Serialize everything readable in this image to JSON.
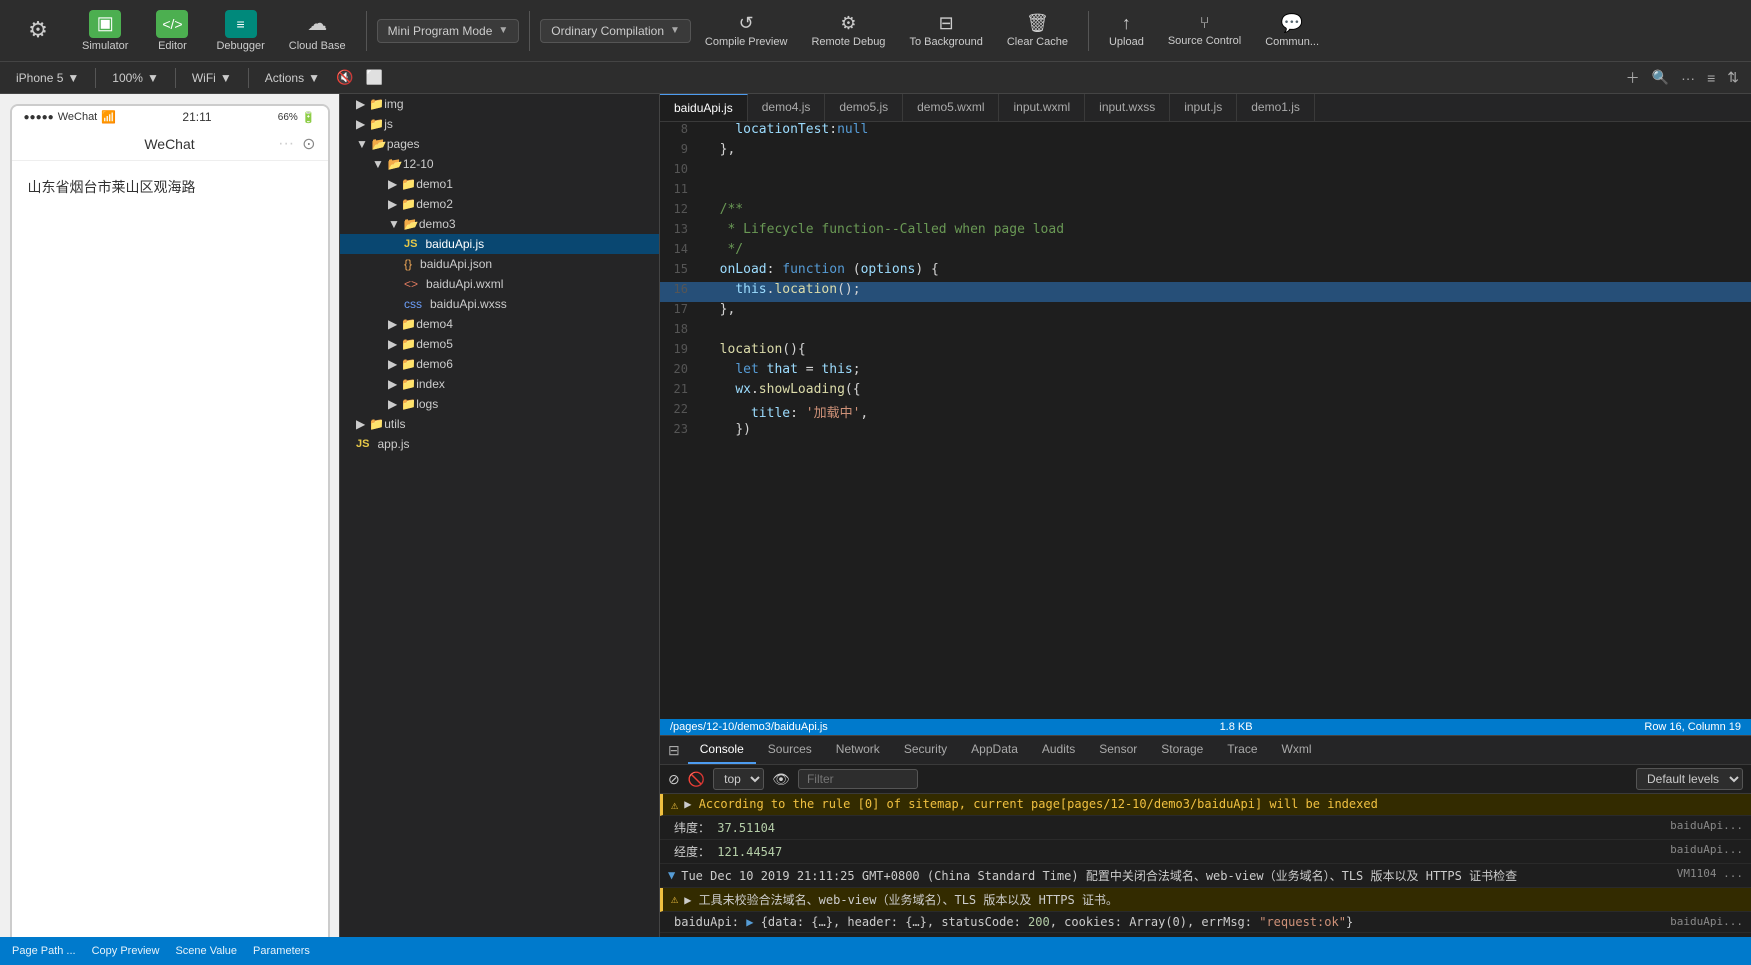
{
  "toolbar": {
    "items": [
      {
        "id": "simulator",
        "label": "Simulator",
        "icon": "▣",
        "style": "green"
      },
      {
        "id": "editor",
        "label": "Editor",
        "icon": "</>",
        "style": "green2"
      },
      {
        "id": "debugger",
        "label": "Debugger",
        "icon": "≡",
        "style": "teal"
      },
      {
        "id": "cloudbase",
        "label": "Cloud Base",
        "icon": "☁",
        "style": "plain"
      }
    ],
    "mode_label": "Mini Program Mode",
    "compile_label": "Ordinary Compilation",
    "compile_preview": "Compile Preview",
    "remote_debug": "Remote Debug",
    "to_background": "To Background",
    "clear_cache": "Clear Cache",
    "upload": "Upload",
    "source_control": "Source Control",
    "commun": "Commun..."
  },
  "subtoolbar": {
    "device": "iPhone 5",
    "zoom": "100%",
    "network": "WiFi",
    "actions": "Actions"
  },
  "phone": {
    "time": "21:11",
    "battery": "66%",
    "signal": "●●●●●",
    "wechat": "WeChat",
    "nav_title": "WeChat",
    "location": "山东省烟台市莱山区观海路"
  },
  "file_tree": {
    "items": [
      {
        "id": "img",
        "label": "img",
        "type": "folder",
        "level": 0,
        "expanded": false
      },
      {
        "id": "js",
        "label": "js",
        "type": "folder",
        "level": 0,
        "expanded": false
      },
      {
        "id": "pages",
        "label": "pages",
        "type": "folder",
        "level": 0,
        "expanded": true
      },
      {
        "id": "12-10",
        "label": "12-10",
        "type": "folder",
        "level": 1,
        "expanded": true
      },
      {
        "id": "demo1",
        "label": "demo1",
        "type": "folder",
        "level": 2,
        "expanded": false
      },
      {
        "id": "demo2",
        "label": "demo2",
        "type": "folder",
        "level": 2,
        "expanded": false
      },
      {
        "id": "demo3",
        "label": "demo3",
        "type": "folder",
        "level": 2,
        "expanded": true
      },
      {
        "id": "baiduApi.js",
        "label": "baiduApi.js",
        "type": "js",
        "level": 3,
        "active": true
      },
      {
        "id": "baiduApi.json",
        "label": "baiduApi.json",
        "type": "json",
        "level": 3
      },
      {
        "id": "baiduApi.wxml",
        "label": "baiduApi.wxml",
        "type": "wxml",
        "level": 3
      },
      {
        "id": "baiduApi.wxss",
        "label": "baiduApi.wxss",
        "type": "wxss",
        "level": 3
      },
      {
        "id": "demo4",
        "label": "demo4",
        "type": "folder",
        "level": 2,
        "expanded": false
      },
      {
        "id": "demo5",
        "label": "demo5",
        "type": "folder",
        "level": 2,
        "expanded": false
      },
      {
        "id": "demo6",
        "label": "demo6",
        "type": "folder",
        "level": 2,
        "expanded": false
      },
      {
        "id": "index",
        "label": "index",
        "type": "folder",
        "level": 2,
        "expanded": false
      },
      {
        "id": "logs",
        "label": "logs",
        "type": "folder",
        "level": 2,
        "expanded": false
      },
      {
        "id": "utils",
        "label": "utils",
        "type": "folder",
        "level": 0,
        "expanded": false
      },
      {
        "id": "app.js",
        "label": "app.js",
        "type": "js",
        "level": 0
      }
    ]
  },
  "editor": {
    "tabs": [
      {
        "id": "demo4.js",
        "label": "demo4.js"
      },
      {
        "id": "demo5.js",
        "label": "demo5.js"
      },
      {
        "id": "demo5.wxml",
        "label": "demo5.wxml"
      },
      {
        "id": "input.wxml",
        "label": "input.wxml"
      },
      {
        "id": "input.wxss",
        "label": "input.wxss"
      },
      {
        "id": "input.js",
        "label": "input.js"
      },
      {
        "id": "demo1.js",
        "label": "demo1.js"
      }
    ],
    "active_tab": "baiduApi.js",
    "file_path": "/pages/12-10/demo3/baiduApi.js",
    "file_size": "1.8 KB",
    "cursor_pos": "Row 16, Column 19",
    "lines": [
      {
        "num": 8,
        "code": "    locationTest:null",
        "highlight": false
      },
      {
        "num": 9,
        "code": "  },",
        "highlight": false
      },
      {
        "num": 10,
        "code": "",
        "highlight": false
      },
      {
        "num": 11,
        "code": "",
        "highlight": false
      },
      {
        "num": 12,
        "code": "  /**",
        "highlight": false
      },
      {
        "num": 13,
        "code": "   * Lifecycle function--Called when page load",
        "highlight": false
      },
      {
        "num": 14,
        "code": "   */",
        "highlight": false
      },
      {
        "num": 15,
        "code": "  onLoad: function (options) {",
        "highlight": false
      },
      {
        "num": 16,
        "code": "    this.location();",
        "highlight": true
      },
      {
        "num": 17,
        "code": "  },",
        "highlight": false
      },
      {
        "num": 18,
        "code": "",
        "highlight": false
      },
      {
        "num": 19,
        "code": "  location(){",
        "highlight": false
      },
      {
        "num": 20,
        "code": "    let that = this;",
        "highlight": false
      },
      {
        "num": 21,
        "code": "    wx.showLoading({",
        "highlight": false
      },
      {
        "num": 22,
        "code": "      title: '加载中',",
        "highlight": false
      },
      {
        "num": 23,
        "code": "    })",
        "highlight": false
      }
    ]
  },
  "devtools": {
    "tabs": [
      "Console",
      "Sources",
      "Network",
      "Security",
      "AppData",
      "Audits",
      "Sensor",
      "Storage",
      "Trace",
      "Wxml"
    ],
    "active_tab": "Console",
    "top_select": "top",
    "filter_placeholder": "Filter",
    "level_select": "Default levels",
    "console_lines": [
      {
        "type": "warning",
        "icon": "⚠",
        "text": "According to the rule [0] of sitemap, current page[pages/12-10/demo3/baiduApi] will be indexed",
        "source": ""
      },
      {
        "type": "info",
        "icon": "",
        "text": "纬度：  37.51104",
        "source": "baiduApi..."
      },
      {
        "type": "info",
        "icon": "",
        "text": "经度：  121.44547",
        "source": "baiduApi..."
      },
      {
        "type": "info",
        "icon": "▼",
        "text": "Tue Dec 10 2019 21:11:25 GMT+0800 (China Standard Time) 配置中关闭合法域名、web-view（业务域名）、TLS 版本以及 HTTPS 证书检查",
        "source": "VM1104 ..."
      },
      {
        "type": "warning",
        "icon": "⚠",
        "text": "▶ 工具未校验合法域名、web-view（业务域名）、TLS 版本以及 HTTPS 证书。",
        "source": ""
      },
      {
        "type": "info",
        "icon": "",
        "text": "baiduApi: ▶ {data: {…}, header: {…}, statusCode: 200, cookies: Array(0), errMsg: \"request:ok\"}",
        "source": "baiduApi..."
      },
      {
        "type": "input",
        "icon": "▶",
        "text": "",
        "source": ""
      }
    ]
  },
  "bottom_bar": {
    "items": [
      "Page Path ...",
      "Copy Preview",
      "Scene Value",
      "Parameters"
    ]
  }
}
